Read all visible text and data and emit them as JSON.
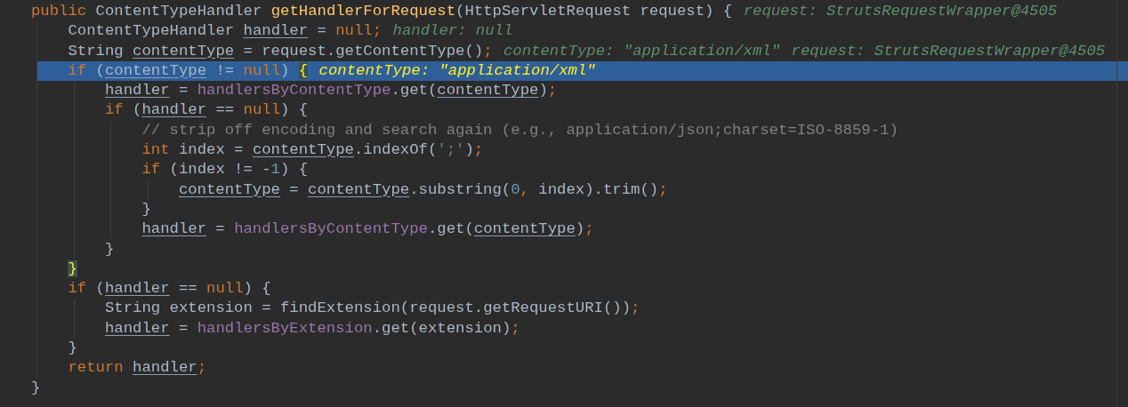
{
  "code_lines": [
    {
      "selected": false,
      "tokens": [
        {
          "kind": "keyword",
          "text": "public"
        },
        {
          "kind": "plain",
          "text": " ContentTypeHandler "
        },
        {
          "kind": "method",
          "text": "getHandlerForRequest"
        },
        {
          "kind": "plain",
          "text": "(HttpServletRequest request) {"
        }
      ],
      "hints": [
        "request: StrutsRequestWrapper@4505"
      ],
      "children": [
        {
          "selected": false,
          "tokens": [
            {
              "kind": "plain",
              "text": "ContentTypeHandler "
            },
            {
              "kind": "variable",
              "text": "handler"
            },
            {
              "kind": "plain",
              "text": " = "
            },
            {
              "kind": "keyword",
              "text": "null;"
            }
          ],
          "hints": [
            "handler: null"
          ]
        },
        {
          "selected": false,
          "tokens": [
            {
              "kind": "plain",
              "text": "String "
            },
            {
              "kind": "variable",
              "text": "contentType"
            },
            {
              "kind": "plain",
              "text": " = request.getContentType()"
            },
            {
              "kind": "keyword",
              "text": ";"
            }
          ],
          "hints": [
            "contentType: \"application/xml\"",
            "request: StrutsRequestWrapper@4505"
          ]
        },
        {
          "selected": true,
          "tokens": [
            {
              "kind": "keyword",
              "text": "if"
            },
            {
              "kind": "plain",
              "text": " ("
            },
            {
              "kind": "variable",
              "text": "contentType"
            },
            {
              "kind": "plain",
              "text": " != "
            },
            {
              "kind": "keyword",
              "text": "null"
            },
            {
              "kind": "plain",
              "text": ") "
            },
            {
              "kind": "brace_match",
              "text": "{"
            }
          ],
          "hints": [
            "contentType: \"application/xml\""
          ],
          "children": [
            {
              "selected": false,
              "tokens": [
                {
                  "kind": "variable",
                  "text": "handler"
                },
                {
                  "kind": "plain",
                  "text": " = "
                },
                {
                  "kind": "field",
                  "text": "handlersByContentType"
                },
                {
                  "kind": "plain",
                  "text": ".get("
                },
                {
                  "kind": "variable",
                  "text": "contentType"
                },
                {
                  "kind": "plain",
                  "text": ")"
                },
                {
                  "kind": "keyword",
                  "text": ";"
                }
              ]
            },
            {
              "selected": false,
              "tokens": [
                {
                  "kind": "keyword",
                  "text": "if"
                },
                {
                  "kind": "plain",
                  "text": " ("
                },
                {
                  "kind": "variable",
                  "text": "handler"
                },
                {
                  "kind": "plain",
                  "text": " == "
                },
                {
                  "kind": "keyword",
                  "text": "null"
                },
                {
                  "kind": "plain",
                  "text": ") {"
                }
              ],
              "children": [
                {
                  "selected": false,
                  "tokens": [
                    {
                      "kind": "comment",
                      "text": "// strip off encoding and search again (e.g., application/json;charset=ISO-8859-1)"
                    }
                  ]
                },
                {
                  "selected": false,
                  "tokens": [
                    {
                      "kind": "keyword",
                      "text": "int"
                    },
                    {
                      "kind": "plain",
                      "text": " index = "
                    },
                    {
                      "kind": "variable",
                      "text": "contentType"
                    },
                    {
                      "kind": "plain",
                      "text": ".indexOf("
                    },
                    {
                      "kind": "string",
                      "text": "';'"
                    },
                    {
                      "kind": "plain",
                      "text": ")"
                    },
                    {
                      "kind": "keyword",
                      "text": ";"
                    }
                  ]
                },
                {
                  "selected": false,
                  "tokens": [
                    {
                      "kind": "keyword",
                      "text": "if"
                    },
                    {
                      "kind": "plain",
                      "text": " (index != -"
                    },
                    {
                      "kind": "number",
                      "text": "1"
                    },
                    {
                      "kind": "plain",
                      "text": ") {"
                    }
                  ],
                  "children": [
                    {
                      "selected": false,
                      "tokens": [
                        {
                          "kind": "variable",
                          "text": "contentType"
                        },
                        {
                          "kind": "plain",
                          "text": " = "
                        },
                        {
                          "kind": "variable",
                          "text": "contentType"
                        },
                        {
                          "kind": "plain",
                          "text": ".substring("
                        },
                        {
                          "kind": "number",
                          "text": "0"
                        },
                        {
                          "kind": "keyword",
                          "text": ","
                        },
                        {
                          "kind": "plain",
                          "text": " index).trim()"
                        },
                        {
                          "kind": "keyword",
                          "text": ";"
                        }
                      ]
                    }
                  ]
                },
                {
                  "selected": false,
                  "tokens": [
                    {
                      "kind": "plain",
                      "text": "}"
                    }
                  ]
                },
                {
                  "selected": false,
                  "tokens": [
                    {
                      "kind": "variable",
                      "text": "handler"
                    },
                    {
                      "kind": "plain",
                      "text": " = "
                    },
                    {
                      "kind": "field",
                      "text": "handlersByContentType"
                    },
                    {
                      "kind": "plain",
                      "text": ".get("
                    },
                    {
                      "kind": "variable",
                      "text": "contentType"
                    },
                    {
                      "kind": "plain",
                      "text": ")"
                    },
                    {
                      "kind": "keyword",
                      "text": ";"
                    }
                  ]
                }
              ]
            },
            {
              "selected": false,
              "tokens": [
                {
                  "kind": "plain",
                  "text": "}"
                }
              ]
            }
          ]
        },
        {
          "selected": false,
          "tokens": [
            {
              "kind": "brace_match_close",
              "text": "}"
            }
          ]
        },
        {
          "selected": false,
          "tokens": [
            {
              "kind": "keyword",
              "text": "if"
            },
            {
              "kind": "plain",
              "text": " ("
            },
            {
              "kind": "variable",
              "text": "handler"
            },
            {
              "kind": "plain",
              "text": " == "
            },
            {
              "kind": "keyword",
              "text": "null"
            },
            {
              "kind": "plain",
              "text": ") {"
            }
          ],
          "children": [
            {
              "selected": false,
              "tokens": [
                {
                  "kind": "plain",
                  "text": "String extension = findExtension(request.getRequestURI())"
                },
                {
                  "kind": "keyword",
                  "text": ";"
                }
              ]
            },
            {
              "selected": false,
              "tokens": [
                {
                  "kind": "variable",
                  "text": "handler"
                },
                {
                  "kind": "plain",
                  "text": " = "
                },
                {
                  "kind": "field",
                  "text": "handlersByExtension"
                },
                {
                  "kind": "plain",
                  "text": ".get(extension)"
                },
                {
                  "kind": "keyword",
                  "text": ";"
                }
              ]
            }
          ]
        },
        {
          "selected": false,
          "tokens": [
            {
              "kind": "plain",
              "text": "}"
            }
          ]
        },
        {
          "selected": false,
          "tokens": [
            {
              "kind": "keyword",
              "text": "return "
            },
            {
              "kind": "variable",
              "text": "handler"
            },
            {
              "kind": "keyword",
              "text": ";"
            }
          ]
        }
      ]
    },
    {
      "selected": false,
      "tokens": [
        {
          "kind": "plain",
          "text": "}"
        }
      ]
    }
  ]
}
